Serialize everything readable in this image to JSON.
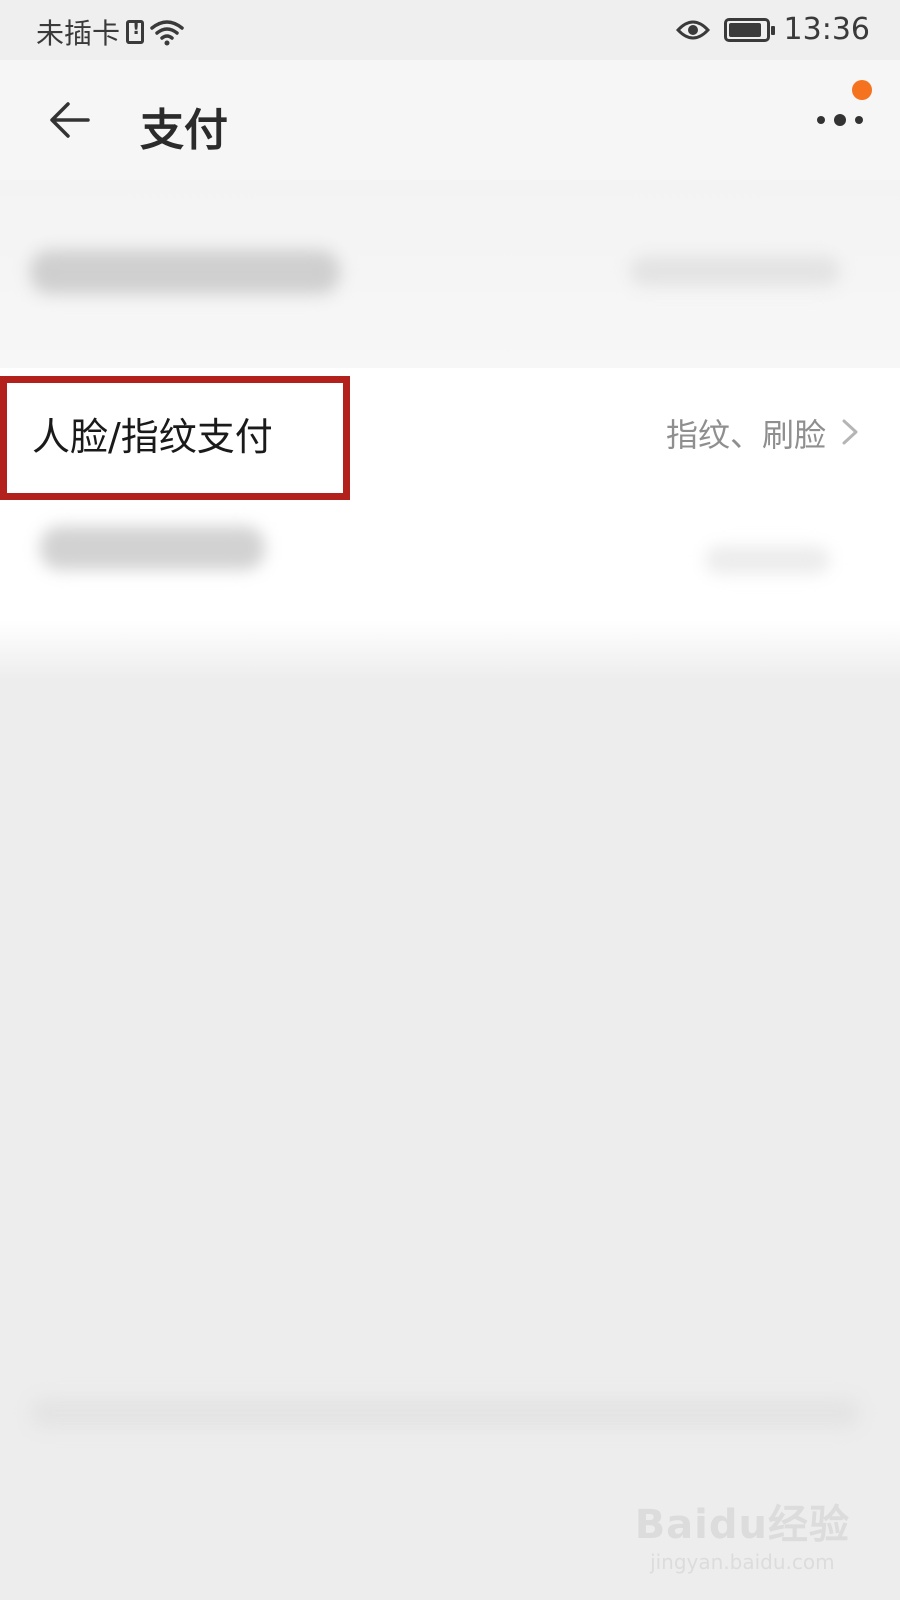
{
  "status_bar": {
    "carrier": "未插卡",
    "time": "13:36"
  },
  "header": {
    "title": "支付"
  },
  "rows": {
    "face_fingerprint": {
      "label": "人脸/指纹支付",
      "value": "指纹、刷脸"
    }
  },
  "watermark": {
    "logo": "Baidu经验",
    "url": "jingyan.baidu.com"
  },
  "colors": {
    "highlight_border": "#b3211c",
    "notification_dot": "#f5721f"
  }
}
